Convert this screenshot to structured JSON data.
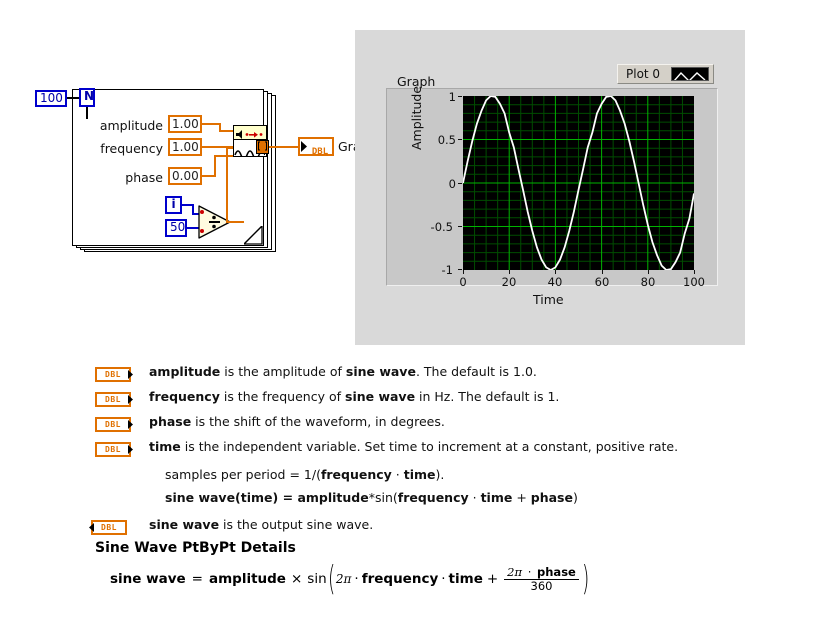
{
  "block_diagram": {
    "count_constant": "100",
    "count_terminal": "N",
    "iteration_terminal": "i",
    "divisor_constant": "50",
    "divide_symbol": "÷",
    "inputs": [
      {
        "label": "amplitude",
        "value": "1.00"
      },
      {
        "label": "frequency",
        "value": "1.00"
      },
      {
        "label": "phase",
        "value": "0.00"
      }
    ],
    "output_terminal": {
      "type": "DBL",
      "label": "Graph"
    }
  },
  "panel": {
    "graph_caption": "Graph",
    "legend": {
      "plot_label": "Plot 0"
    }
  },
  "chart_data": {
    "type": "line",
    "title": "Graph",
    "xlabel": "Time",
    "ylabel": "Amplitude",
    "xlim": [
      0,
      100
    ],
    "ylim": [
      -1,
      1
    ],
    "xticks": [
      "0",
      "20",
      "40",
      "60",
      "80",
      "100"
    ],
    "yticks": [
      "1",
      "0.5",
      "0",
      "-0.5",
      "-1"
    ],
    "grid": true,
    "grid_color": "#00aa00",
    "minor_grid_color": "#004400",
    "background": "#000000",
    "legend_position": "top-right",
    "series": [
      {
        "name": "Plot 0",
        "color": "#ffffff",
        "description": "sine wave, amplitude 1.0, period 50 samples, phase 0",
        "amplitude": 1.0,
        "period": 50,
        "phase_deg": 0,
        "x": [
          0,
          2,
          4,
          6,
          8,
          10,
          12,
          14,
          16,
          18,
          20,
          22,
          24,
          26,
          28,
          30,
          32,
          34,
          36,
          38,
          40,
          42,
          44,
          46,
          48,
          50,
          52,
          54,
          56,
          58,
          60,
          62,
          64,
          66,
          68,
          70,
          72,
          74,
          76,
          78,
          80,
          82,
          84,
          86,
          88,
          90,
          92,
          94,
          96,
          98,
          100
        ],
        "y": [
          0.0,
          0.25,
          0.48,
          0.68,
          0.84,
          0.95,
          1.0,
          0.99,
          0.92,
          0.81,
          0.59,
          0.41,
          0.16,
          -0.08,
          -0.33,
          -0.55,
          -0.74,
          -0.88,
          -0.97,
          -1.0,
          -0.97,
          -0.88,
          -0.74,
          -0.55,
          -0.33,
          -0.08,
          0.16,
          0.41,
          0.59,
          0.81,
          0.92,
          0.99,
          1.0,
          0.95,
          0.84,
          0.68,
          0.48,
          0.25,
          0.0,
          -0.25,
          -0.48,
          -0.68,
          -0.84,
          -0.95,
          -1.0,
          -0.99,
          -0.92,
          -0.81,
          -0.59,
          -0.41,
          -0.12
        ]
      }
    ]
  },
  "descriptions": [
    {
      "icon": "DBL",
      "direction": "input",
      "parts": [
        {
          "t": "amplitude",
          "b": true
        },
        {
          "t": " is the amplitude of ",
          "b": false
        },
        {
          "t": "sine wave",
          "b": true
        },
        {
          "t": ". The default is 1.0.",
          "b": false
        }
      ]
    },
    {
      "icon": "DBL",
      "direction": "input",
      "parts": [
        {
          "t": "frequency",
          "b": true
        },
        {
          "t": " is the frequency of ",
          "b": false
        },
        {
          "t": "sine wave",
          "b": true
        },
        {
          "t": " in Hz. The default is 1.",
          "b": false
        }
      ]
    },
    {
      "icon": "DBL",
      "direction": "input",
      "parts": [
        {
          "t": "phase",
          "b": true
        },
        {
          "t": " is the shift of the waveform, in degrees.",
          "b": false
        }
      ]
    },
    {
      "icon": "DBL",
      "direction": "input",
      "parts": [
        {
          "t": "time",
          "b": true
        },
        {
          "t": " is the independent variable. Set time to increment at a constant, positive rate.",
          "b": false
        }
      ]
    }
  ],
  "sub_lines": [
    [
      {
        "t": "samples per period = 1/(",
        "b": false
      },
      {
        "t": "frequency",
        "b": true
      },
      {
        "t": " · ",
        "b": false
      },
      {
        "t": "time",
        "b": true
      },
      {
        "t": ").",
        "b": false
      }
    ],
    [
      {
        "t": "sine wave(time)",
        "b": true
      },
      {
        "t": " = ",
        "b": true
      },
      {
        "t": "amplitude",
        "b": true
      },
      {
        "t": "*sin(",
        "b": false
      },
      {
        "t": "frequency",
        "b": true
      },
      {
        "t": " · ",
        "b": false
      },
      {
        "t": "time",
        "b": true
      },
      {
        "t": " + ",
        "b": false
      },
      {
        "t": "phase",
        "b": true
      },
      {
        "t": ")",
        "b": false
      }
    ]
  ],
  "output_description": {
    "icon": "DBL",
    "direction": "output",
    "parts": [
      {
        "t": "sine wave",
        "b": true
      },
      {
        "t": " is the output sine wave.",
        "b": false
      }
    ]
  },
  "details_heading": "Sine Wave PtByPt Details",
  "formula": {
    "lhs": "sine wave",
    "equals": "=",
    "amplitude": "amplitude",
    "times": "×",
    "sin": "sin",
    "open_paren": "(",
    "close_paren": ")",
    "two_pi": "2π",
    "dot": "·",
    "frequency": "frequency",
    "time": "time",
    "plus": "+",
    "numerator_two_pi": "2π",
    "numerator_phase": "phase",
    "denominator": "360"
  }
}
